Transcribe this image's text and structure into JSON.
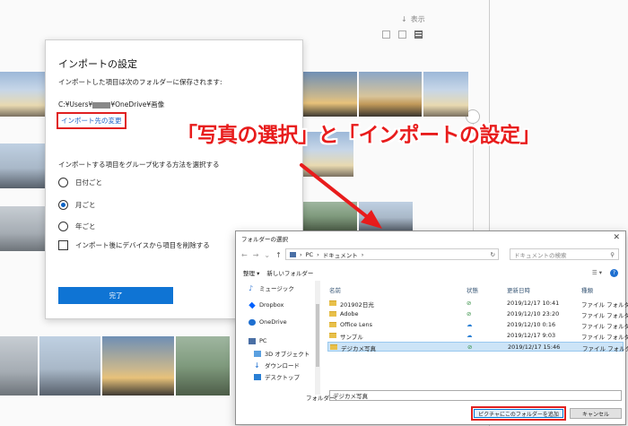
{
  "background": {
    "view_label": "表示"
  },
  "import_dialog": {
    "title": "インポートの設定",
    "description": "インポートした項目は次のフォルダーに保存されます:",
    "path_prefix": "C:¥Users¥",
    "path_suffix": "¥OneDrive¥画像",
    "change_link": "インポート先の変更",
    "group_label": "インポートする項目をグループ化する方法を選択する",
    "options": [
      {
        "label": "日付ごと",
        "checked": false
      },
      {
        "label": "月ごと",
        "checked": true
      },
      {
        "label": "年ごと",
        "checked": false
      }
    ],
    "delete_checkbox": "インポート後にデバイスから項目を削除する",
    "done_button": "完了"
  },
  "annotation": {
    "text": "「写真の選択」と「インポートの設定」",
    "color": "#e81c1c"
  },
  "folder_dialog": {
    "title": "フォルダーの選択",
    "address": [
      "PC",
      "ドキュメント"
    ],
    "search_placeholder": "ドキュメントの検索",
    "toolbar": {
      "organize": "整理 ▾",
      "new_folder": "新しいフォルダー"
    },
    "nav_items": [
      {
        "label": "ミュージック",
        "icon": "music-icon"
      },
      {
        "label": "Dropbox",
        "icon": "dropbox-icon"
      },
      {
        "label": "OneDrive",
        "icon": "onedrive-icon"
      },
      {
        "label": "PC",
        "icon": "pc-icon"
      },
      {
        "label": "3D オブジェクト",
        "icon": "3d-objects-icon"
      },
      {
        "label": "ダウンロード",
        "icon": "download-icon"
      },
      {
        "label": "デスクトップ",
        "icon": "desktop-icon"
      }
    ],
    "columns": {
      "name": "名前",
      "status": "状態",
      "date": "更新日時",
      "type": "種類"
    },
    "rows": [
      {
        "name": "201902日光",
        "status": "ok",
        "date": "2019/12/17 10:41",
        "type": "ファイル フォルダー"
      },
      {
        "name": "Adobe",
        "status": "ok",
        "date": "2019/12/10 23:20",
        "type": "ファイル フォルダー"
      },
      {
        "name": "Office Lens",
        "status": "cloud",
        "date": "2019/12/10 0:16",
        "type": "ファイル フォルダー"
      },
      {
        "name": "サンプル",
        "status": "cloud",
        "date": "2019/12/17 9:03",
        "type": "ファイル フォルダー"
      },
      {
        "name": "デジカメ写真",
        "status": "ok",
        "date": "2019/12/17 15:46",
        "type": "ファイル フォルダー",
        "selected": true
      }
    ],
    "folder_label": "フォルダー:",
    "folder_value": "デジカメ写真",
    "add_button": "ピクチャにこのフォルダーを追加",
    "cancel_button": "キャンセル"
  }
}
